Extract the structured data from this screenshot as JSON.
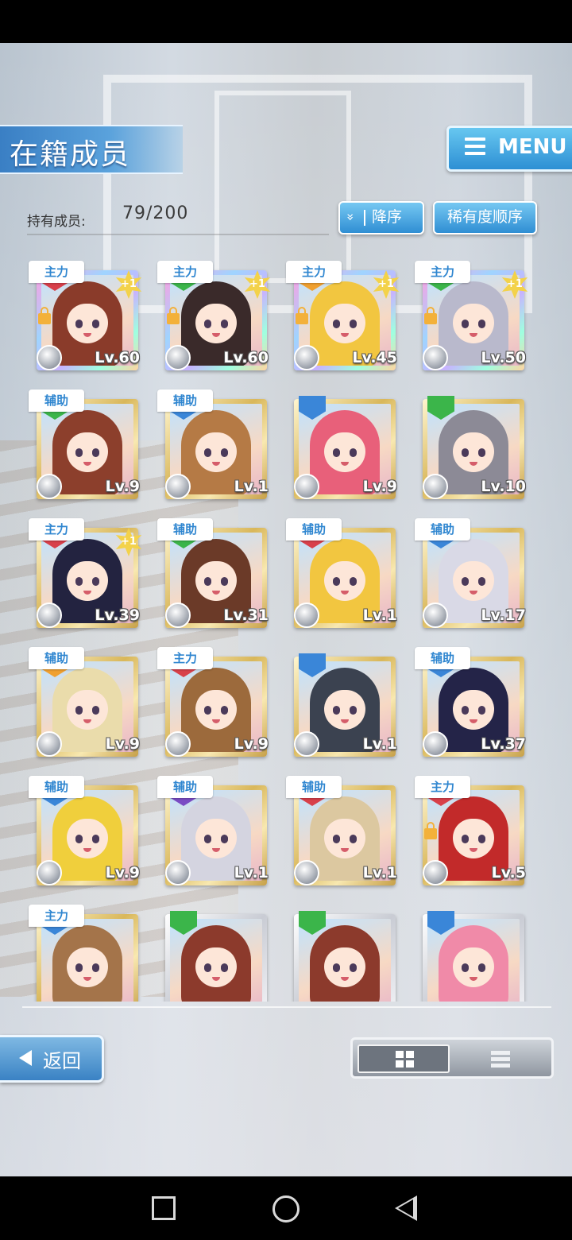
{
  "header": {
    "title": "在籍成员",
    "menu_label": "MENU"
  },
  "owned": {
    "label": "持有成员:",
    "value": "79/200"
  },
  "sort": {
    "chevron": "»",
    "order_label": "降序",
    "rarity_label": "稀有度顺序"
  },
  "cards": [
    {
      "role": "主力",
      "level": "Lv.60",
      "frame": "rainbow",
      "plus": "+1",
      "locked": true,
      "badge": "#d8404a",
      "hair": "#8a3b2a"
    },
    {
      "role": "主力",
      "level": "Lv.60",
      "frame": "rainbow",
      "plus": "+1",
      "locked": true,
      "badge": "#3bb54a",
      "hair": "#3a2a2a"
    },
    {
      "role": "主力",
      "level": "Lv.45",
      "frame": "rainbow",
      "plus": "+1",
      "locked": true,
      "badge": "#f0a030",
      "hair": "#f2c640"
    },
    {
      "role": "主力",
      "level": "Lv.50",
      "frame": "rainbow",
      "plus": "+1",
      "locked": true,
      "badge": "#3bb54a",
      "hair": "#b9b9cc"
    },
    {
      "role": "辅助",
      "level": "Lv.9",
      "frame": "gold",
      "plus": "",
      "locked": false,
      "badge": "#3bb54a",
      "hair": "#8c3f2c"
    },
    {
      "role": "辅助",
      "level": "Lv.1",
      "frame": "gold",
      "plus": "",
      "locked": false,
      "badge": "#3a86d8",
      "hair": "#b57a45"
    },
    {
      "role": "",
      "level": "Lv.9",
      "frame": "gold",
      "plus": "",
      "locked": false,
      "badge": "#3a86d8",
      "hair": "#e8607a"
    },
    {
      "role": "",
      "level": "Lv.10",
      "frame": "gold",
      "plus": "",
      "locked": false,
      "badge": "#3bb54a",
      "hair": "#8c8a96"
    },
    {
      "role": "主力",
      "level": "Lv.39",
      "frame": "gold",
      "plus": "+1",
      "locked": false,
      "badge": "#d8404a",
      "hair": "#232340"
    },
    {
      "role": "辅助",
      "level": "Lv.31",
      "frame": "gold",
      "plus": "",
      "locked": false,
      "badge": "#3bb54a",
      "hair": "#6b3a28"
    },
    {
      "role": "辅助",
      "level": "Lv.1",
      "frame": "gold",
      "plus": "",
      "locked": false,
      "badge": "#d8404a",
      "hair": "#f2c640"
    },
    {
      "role": "辅助",
      "level": "Lv.17",
      "frame": "gold",
      "plus": "",
      "locked": false,
      "badge": "#3a86d8",
      "hair": "#d9d9e6"
    },
    {
      "role": "辅助",
      "level": "Lv.9",
      "frame": "gold",
      "plus": "",
      "locked": false,
      "badge": "#f0a030",
      "hair": "#eadcab"
    },
    {
      "role": "主力",
      "level": "Lv.9",
      "frame": "gold",
      "plus": "",
      "locked": false,
      "badge": "#d8404a",
      "hair": "#9c6a3c"
    },
    {
      "role": "",
      "level": "Lv.1",
      "frame": "gold",
      "plus": "",
      "locked": false,
      "badge": "#3a86d8",
      "hair": "#3b4250"
    },
    {
      "role": "辅助",
      "level": "Lv.37",
      "frame": "gold",
      "plus": "",
      "locked": false,
      "badge": "#3a86d8",
      "hair": "#242448"
    },
    {
      "role": "辅助",
      "level": "Lv.9",
      "frame": "gold",
      "plus": "",
      "locked": false,
      "badge": "#3a86d8",
      "hair": "#f0cf3c"
    },
    {
      "role": "辅助",
      "level": "Lv.1",
      "frame": "gold",
      "plus": "",
      "locked": false,
      "badge": "#7a4cc4",
      "hair": "#d4d4e0"
    },
    {
      "role": "辅助",
      "level": "Lv.1",
      "frame": "gold",
      "plus": "",
      "locked": false,
      "badge": "#d8404a",
      "hair": "#dcc8a0"
    },
    {
      "role": "主力",
      "level": "Lv.5",
      "frame": "gold",
      "plus": "",
      "locked": true,
      "badge": "#d8404a",
      "hair": "#c22a2a"
    },
    {
      "role": "主力",
      "level": "",
      "frame": "gold",
      "plus": "",
      "locked": false,
      "badge": "#3a86d8",
      "hair": "#a4744a"
    },
    {
      "role": "",
      "level": "",
      "frame": "silver",
      "plus": "",
      "locked": false,
      "badge": "#3bb54a",
      "hair": "#8c3a2c"
    },
    {
      "role": "",
      "level": "",
      "frame": "silver",
      "plus": "",
      "locked": false,
      "badge": "#3bb54a",
      "hair": "#8c3a2c"
    },
    {
      "role": "",
      "level": "",
      "frame": "silver",
      "plus": "",
      "locked": false,
      "badge": "#3a86d8",
      "hair": "#f08aa8"
    }
  ],
  "footer": {
    "back_label": "返回"
  }
}
